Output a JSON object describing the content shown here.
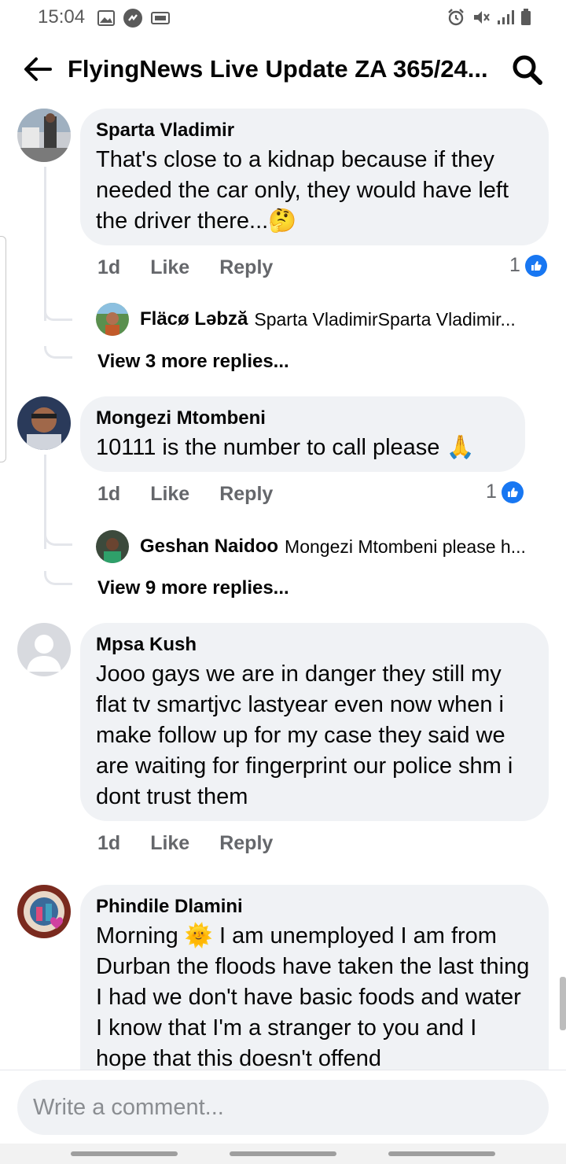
{
  "status_bar": {
    "time": "15:04",
    "left_icons": [
      "image-icon",
      "messenger-icon",
      "cast-icon"
    ],
    "right_icons": [
      "alarm-icon",
      "mute-icon",
      "signal-icon",
      "battery-icon"
    ]
  },
  "header": {
    "title": "FlyingNews Live Update ZA 365/24...",
    "back_icon": "arrow-left-icon",
    "search_icon": "search-icon"
  },
  "comments": [
    {
      "author": "Sparta Vladimir",
      "text": "That's close to a kidnap because if they needed the car only, they would have left the driver there...🤔",
      "time": "1d",
      "like_label": "Like",
      "reply_label": "Reply",
      "reaction_count": "1",
      "reply_preview": {
        "author": "Fläcø Ləbză",
        "snippet": "Sparta VladimirSparta Vladimir..."
      },
      "view_more": "View 3 more replies..."
    },
    {
      "author": "Mongezi Mtombeni",
      "text": "10111 is the number to call please 🙏",
      "time": "1d",
      "like_label": "Like",
      "reply_label": "Reply",
      "reaction_count": "1",
      "reply_preview": {
        "author": "Geshan Naidoo",
        "snippet": "Mongezi Mtombeni please h..."
      },
      "view_more": "View 9 more replies..."
    },
    {
      "author": "Mpsa Kush",
      "text": "Jooo gays we are in danger they still my flat tv smartjvc lastyear even now when i make follow up for my case they said we are waiting for fingerprint our police shm i dont trust them",
      "time": "1d",
      "like_label": "Like",
      "reply_label": "Reply"
    },
    {
      "author": "Phindile Dlamini",
      "text": "Morning 🌞 I am unemployed I am from Durban the  floods have taken the last thing I had we don't have basic foods and water I know that I'm a stranger to you and I hope that this doesn't offend"
    }
  ],
  "composer": {
    "placeholder": "Write a comment..."
  },
  "colors": {
    "bubble_bg": "#f0f2f5",
    "meta_text": "#65676b",
    "like_blue": "#1877f2"
  }
}
